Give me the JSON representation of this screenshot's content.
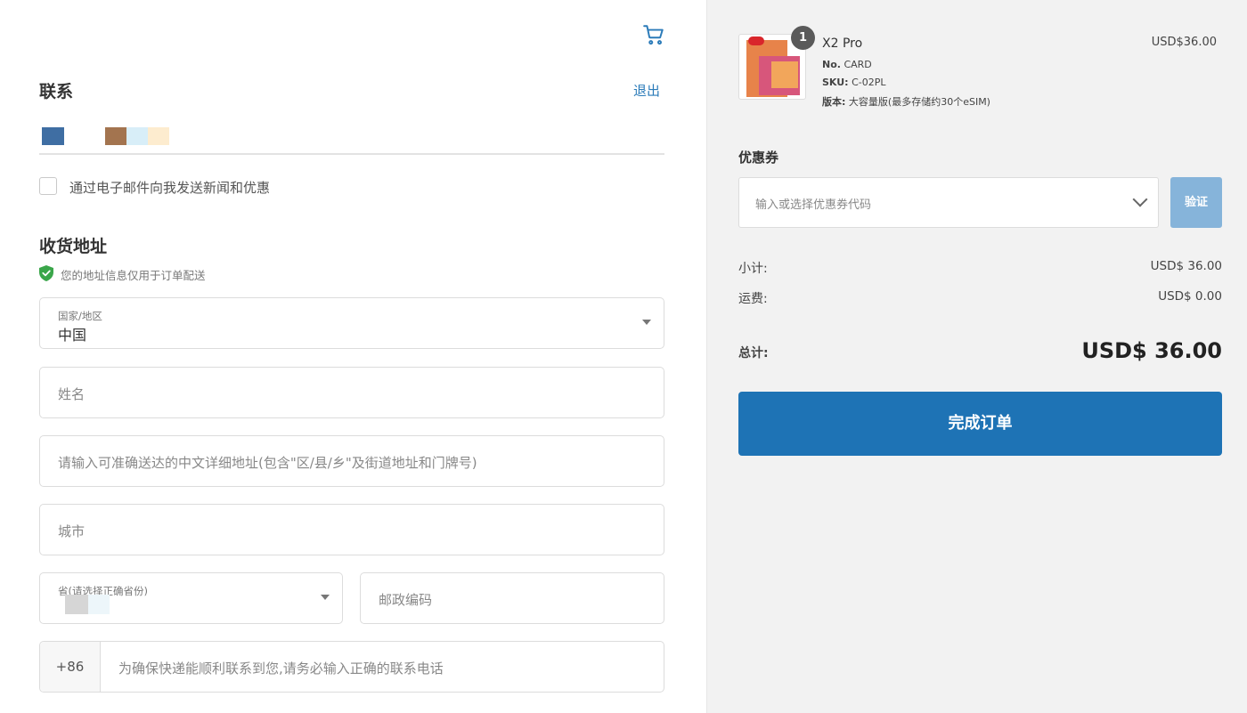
{
  "header": {
    "cart_icon": "shopping-cart-icon"
  },
  "contact": {
    "title": "联系",
    "logout_label": "退出",
    "newsletter_label": "通过电子邮件向我发送新闻和优惠"
  },
  "shipping": {
    "title": "收货地址",
    "privacy_note": "您的地址信息仅用于订单配送",
    "country_label": "国家/地区",
    "country_value": "中国",
    "name_placeholder": "姓名",
    "address_placeholder": "请输入可准确送达的中文详细地址(包含\"区/县/乡\"及街道地址和门牌号)",
    "city_placeholder": "城市",
    "province_label": "省(请选择正确省份)",
    "postal_placeholder": "邮政编码",
    "phone_prefix": "+86",
    "phone_placeholder": "为确保快递能顺利联系到您,请务必输入正确的联系电话"
  },
  "order": {
    "quantity": "1",
    "product_name": "X2 Pro",
    "product_price": "USD$36.00",
    "meta_no_label": "No.",
    "meta_no_value": "CARD",
    "meta_sku_label": "SKU:",
    "meta_sku_value": "C-02PL",
    "meta_version_label": "版本:",
    "meta_version_value": "大容量版(最多存储约30个eSIM)",
    "coupon_title": "优惠券",
    "coupon_placeholder": "输入或选择优惠券代码",
    "verify_label": "验证",
    "subtotal_label": "小计:",
    "subtotal_value": "USD$ 36.00",
    "shipping_label": "运费:",
    "shipping_value": "USD$ 0.00",
    "total_label": "总计:",
    "total_value": "USD$ 36.00",
    "place_order_label": "完成订单"
  },
  "colors": {
    "accent": "#1e73b5",
    "verify_button": "#86b4da",
    "link": "#2b7bb9",
    "shield": "#3aa64a"
  }
}
